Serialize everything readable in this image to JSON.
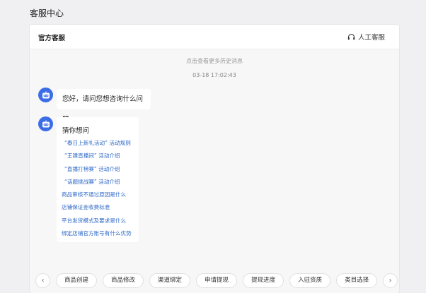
{
  "page": {
    "title": "客服中心"
  },
  "header": {
    "title": "官方客服",
    "human_service": "人工客服"
  },
  "chat": {
    "history_link": "点击查看更多历史消息",
    "timestamp": "03-18 17:02:43",
    "greeting": "您好，请问您想咨询什么问题",
    "guess_title": "猜你想问",
    "questions": [
      "“春日上新礼活动” 活动规则",
      "“王建直播间” 活动介绍",
      "“直播打榜赛” 活动介绍",
      "“话题挑战赛” 活动介绍",
      "商品审核不通过原因是什么",
      "店铺保证金收费标准",
      "平台发货模式及要求是什么",
      "绑定店铺官方账号有什么优势"
    ]
  },
  "quick_bar": {
    "prev_icon": "chevron-left-icon",
    "next_icon": "chevron-right-icon",
    "chips": [
      "商品创建",
      "商品修改",
      "渠道绑定",
      "申请提现",
      "提现进度",
      "入驻资质",
      "类目选择"
    ]
  },
  "colors": {
    "accent": "#3b6de6",
    "link": "#2e68c7"
  }
}
